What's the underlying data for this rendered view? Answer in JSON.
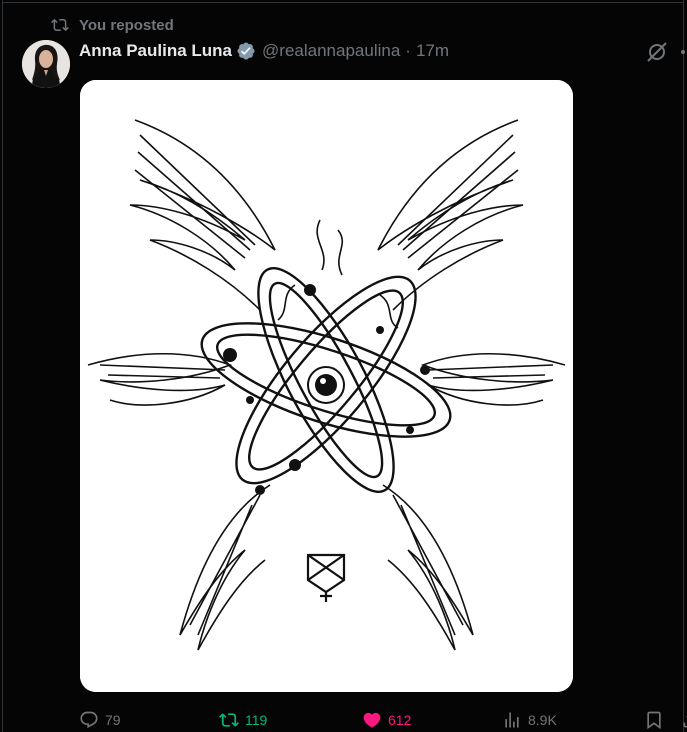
{
  "repost_banner": {
    "text": "You reposted",
    "icon": "repost-icon"
  },
  "tweet": {
    "author_name": "Anna Paulina Luna",
    "verified": true,
    "handle": "@realannapaulina",
    "separator": "·",
    "time": "17m",
    "media_alt_description_visible": false
  },
  "actions": {
    "reply": {
      "icon": "reply-icon",
      "count": "79"
    },
    "repost": {
      "icon": "repost-icon",
      "count": "119",
      "color": "#00ba7c"
    },
    "like": {
      "icon": "heart-icon",
      "count": "612",
      "color": "#f91880"
    },
    "views": {
      "icon": "views-icon",
      "count": "8.9K"
    },
    "bookmark": {
      "icon": "bookmark-icon"
    },
    "share": {
      "icon": "share-icon"
    }
  },
  "colors": {
    "background": "#000000",
    "muted": "#71767b",
    "text": "#e7e9ea",
    "verified": "#1d9bf0"
  }
}
